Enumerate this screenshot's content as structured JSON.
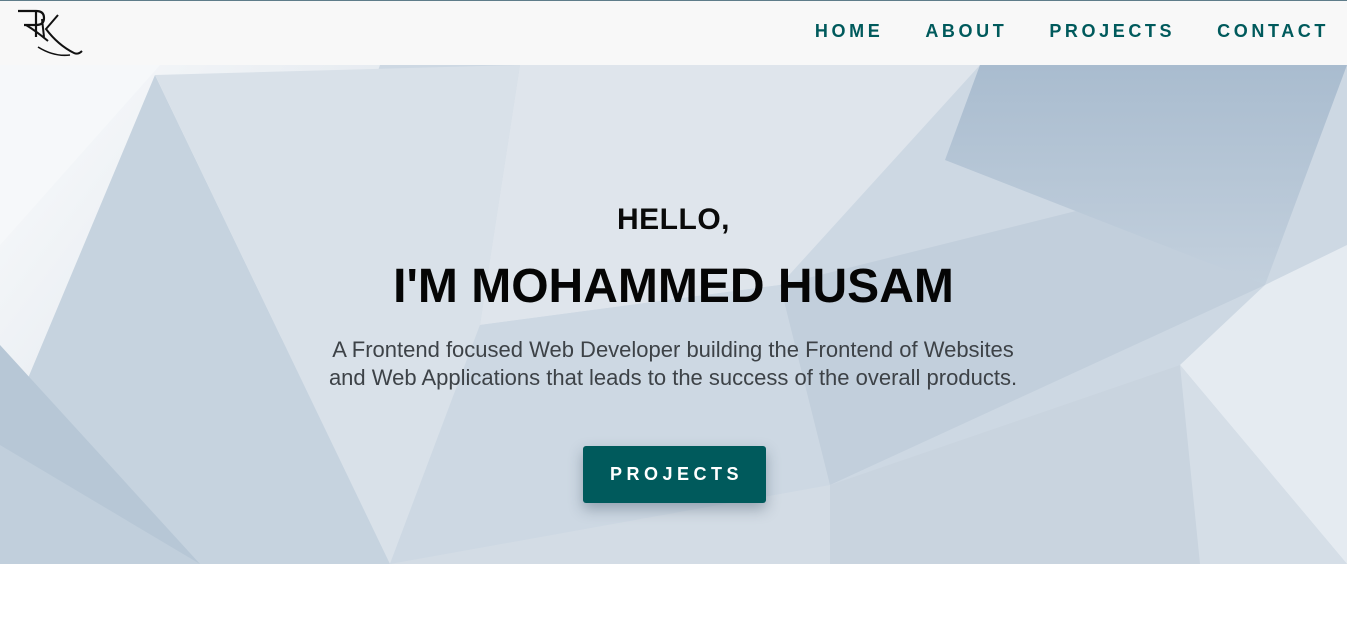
{
  "logo": {
    "alt": "RK logo"
  },
  "nav": {
    "items": [
      {
        "label": "HOME"
      },
      {
        "label": "ABOUT"
      },
      {
        "label": "PROJECTS"
      },
      {
        "label": "CONTACT"
      }
    ]
  },
  "hero": {
    "greeting": "HELLO,",
    "name": "I'M MOHAMMED HUSAM",
    "tagline": "A Frontend focused Web Developer building the Frontend of Websites and Web Applications that leads to the success of the overall products.",
    "cta_label": "PROJECTS"
  },
  "colors": {
    "accent": "#005a5c",
    "navbar_bg": "#f8f8f8",
    "hero_bg": "#c9d4df"
  }
}
